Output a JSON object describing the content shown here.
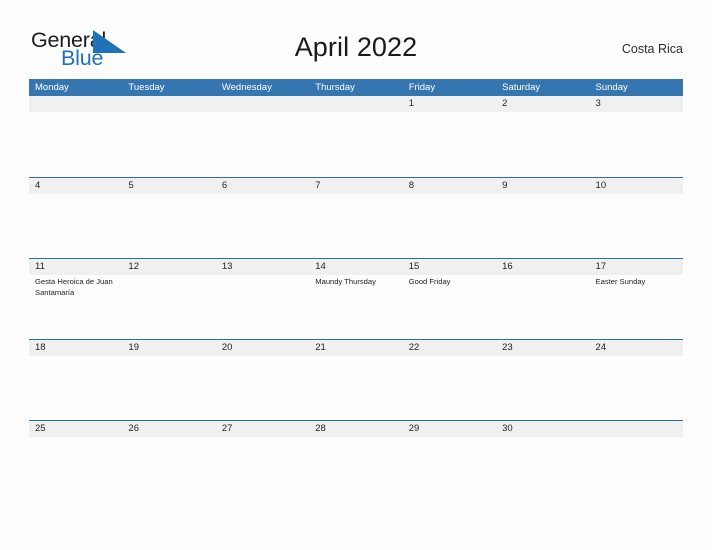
{
  "brand": {
    "word_one": "General",
    "word_two": "Blue",
    "flag_icon": "blue-triangle-flag",
    "primary_color": "#1f72b8"
  },
  "header": {
    "title": "April 2022",
    "region": "Costa Rica"
  },
  "calendar": {
    "accent_color": "#3575b0",
    "band_color": "#f0f0f0",
    "weekdays": [
      "Monday",
      "Tuesday",
      "Wednesday",
      "Thursday",
      "Friday",
      "Saturday",
      "Sunday"
    ],
    "weeks": [
      [
        {
          "date": "",
          "events": []
        },
        {
          "date": "",
          "events": []
        },
        {
          "date": "",
          "events": []
        },
        {
          "date": "",
          "events": []
        },
        {
          "date": "1",
          "events": []
        },
        {
          "date": "2",
          "events": []
        },
        {
          "date": "3",
          "events": []
        }
      ],
      [
        {
          "date": "4",
          "events": []
        },
        {
          "date": "5",
          "events": []
        },
        {
          "date": "6",
          "events": []
        },
        {
          "date": "7",
          "events": []
        },
        {
          "date": "8",
          "events": []
        },
        {
          "date": "9",
          "events": []
        },
        {
          "date": "10",
          "events": []
        }
      ],
      [
        {
          "date": "11",
          "events": [
            "Gesta Heroica de Juan Santamaría"
          ]
        },
        {
          "date": "12",
          "events": []
        },
        {
          "date": "13",
          "events": []
        },
        {
          "date": "14",
          "events": [
            "Maundy Thursday"
          ]
        },
        {
          "date": "15",
          "events": [
            "Good Friday"
          ]
        },
        {
          "date": "16",
          "events": []
        },
        {
          "date": "17",
          "events": [
            "Easter Sunday"
          ]
        }
      ],
      [
        {
          "date": "18",
          "events": []
        },
        {
          "date": "19",
          "events": []
        },
        {
          "date": "20",
          "events": []
        },
        {
          "date": "21",
          "events": []
        },
        {
          "date": "22",
          "events": []
        },
        {
          "date": "23",
          "events": []
        },
        {
          "date": "24",
          "events": []
        }
      ],
      [
        {
          "date": "25",
          "events": []
        },
        {
          "date": "26",
          "events": []
        },
        {
          "date": "27",
          "events": []
        },
        {
          "date": "28",
          "events": []
        },
        {
          "date": "29",
          "events": []
        },
        {
          "date": "30",
          "events": []
        },
        {
          "date": "",
          "events": []
        }
      ]
    ]
  }
}
